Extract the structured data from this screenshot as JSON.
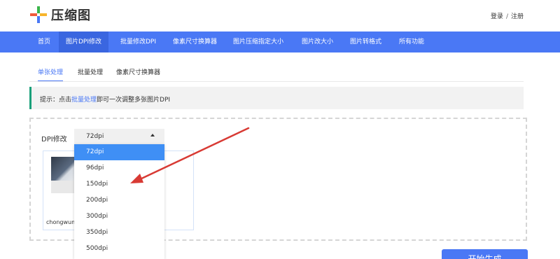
{
  "header": {
    "logo_text": "压缩图",
    "login": "登录",
    "separator": "/",
    "register": "注册"
  },
  "nav": {
    "items": [
      {
        "label": "首页"
      },
      {
        "label": "图片DPI修改",
        "active": true
      },
      {
        "label": "批量修改DPI"
      },
      {
        "label": "像素尺寸换算器"
      },
      {
        "label": "图片压缩指定大小"
      },
      {
        "label": "图片改大小"
      },
      {
        "label": "图片转格式"
      },
      {
        "label": "所有功能"
      }
    ]
  },
  "tabs": [
    {
      "label": "单张处理",
      "active": true
    },
    {
      "label": "批量处理"
    },
    {
      "label": "像素尺寸换算器"
    }
  ],
  "tip": {
    "prefix": "提示：点击",
    "link": "批量处理",
    "suffix": "即可一次调整多张图片DPI"
  },
  "dpi": {
    "label": "DPI修改",
    "selected": "72dpi",
    "options": [
      "72dpi",
      "96dpi",
      "150dpi",
      "200dpi",
      "300dpi",
      "350dpi",
      "500dpi"
    ]
  },
  "image_card": {
    "filename": "chongwuma"
  },
  "start_button": "开始生成",
  "colors": {
    "primary": "#4a78f5",
    "tip_border": "#1aa07a",
    "option_selected": "#3f8ff5",
    "arrow": "#d83a34"
  }
}
